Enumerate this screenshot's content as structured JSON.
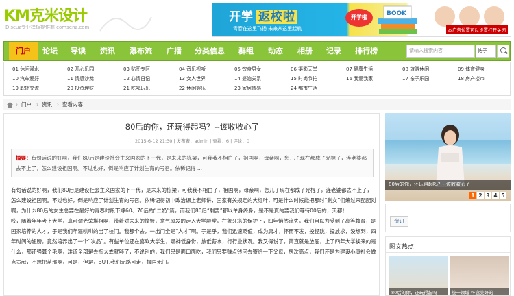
{
  "logo": {
    "mark": "KM克米设计",
    "subtitle": "Discuz专业模板提供商  comsenz.com"
  },
  "banner": {
    "title_a": "开学",
    "title_b": "返校啦",
    "subtitle": "青春在这里飞扬 未来从这里起航",
    "badge": "开学啦",
    "books_text": "BOOK",
    "ad_note": "本广告位置可以设置打开关闭"
  },
  "nav": {
    "items": [
      "门户",
      "论坛",
      "导读",
      "资讯",
      "瀑布流",
      "广播",
      "分类信息",
      "群组",
      "动态",
      "相册",
      "记录",
      "排行榜"
    ],
    "search_placeholder": "请输入搜索内容",
    "search_type": "帖子"
  },
  "subnav": {
    "rows": [
      [
        "01 休闲灌水",
        "02 开心乐园",
        "03 贴图专区",
        "04 音乐视听",
        "05 饮食男女",
        "06 摄影天堂",
        "07 健康生活",
        "08 旅游休闲",
        "09 体育健身"
      ],
      [
        "10 汽车爱好",
        "11 情感沙龙",
        "12 心情日记",
        "13 女人世界",
        "14 婆媳关系",
        "15 时尚节拍",
        "16 我爱我家",
        "17 亲子乐园",
        "18 房产楼市"
      ],
      [
        "19 职场交流",
        "20 投资理财",
        "21 吃喝玩乐",
        "22 休闲娱乐",
        "23 家居情感",
        "24 都市生活"
      ]
    ]
  },
  "breadcrumb": {
    "items": [
      "门户",
      "资讯",
      "查看内容"
    ]
  },
  "article": {
    "title": "80后的你，还玩得起吗？--该收收心了",
    "meta": "2015-6-12 21:30  |  发布者：admin  |  查看：6  |  评论：0",
    "summary_label": "摘要：",
    "summary_text": "有句话说的好啊，我们80后是建设社会主义国家的下一代，是未来的栋梁，可我我不相白了，祖国啊，母亲啊，您儿子现在都成了光棍了，连老婆都去不上了，怎么建设祖国啊。不过也好，倒是响应了计划生育的号召。依稀记得 ...",
    "paragraphs": [
      "有句话说的好啊，我们80后是建设社会主义国家的下一代，是未来的栋梁，可我我不相白了，祖国啊，母亲啊，您儿子现在都成了光棍了，连老婆都去不上了，怎么建设祖国啊。不过也好，倒是响应了计划生育的号召。依稀记得初中政治课上老师讲，国家有关规定的大红叶，可是什么时候能把那时“剩女”们编过来配配对啊，为什么80后的女生总要在最好的青春时段下嫁60、70后的“二奶”篇，而我们80后“剩男”都以单身终身，是不是真的要我们等待00后的，天都！",
      "哎，随着年年考上大学，真可谓光荣堪祖啊，带着对未来的憧憬，意气风发的走入大学殿堂，在象牙塔的保护下，四年悄然流失，我们自以为受到了高等教育，是国家培养的人才，于是我们年逼哄哄的出了校门。我都个去，一出门全是“人才”啊。于是乎，我们迅速贬值，成为庸才，怀而不发，投径跳，投放求，没想到，四年时间的翅膀，竟然培养出了一个“次品”。有些单位还在喜欢大学生，哪神低身份，放低薪水，行行业状况。我又得说了，简直就是放屁，上了四年大学换来的是什么，那还强算个毛啊，难道全部是去掏大粪就够了，不说别的，我们只是面口面吃，我们只要赚点钱回去寄给一下父母，房次高点，我们还是为建设小康社会做点贡献，不想把苗那啊，可是，但是，BUT,我们无路可走，报国无门。"
    ]
  },
  "slider": {
    "caption": "80后的你，还玩得起吗？--该收收心了",
    "dots": [
      "1",
      "2",
      "3",
      "4",
      "5"
    ],
    "active": 0
  },
  "tags": {
    "items": [
      "资讯"
    ]
  },
  "hot": {
    "heading": "图文热点",
    "items": [
      "80后的你，还玩得起吗",
      "统一领域 怀念美好的"
    ]
  }
}
